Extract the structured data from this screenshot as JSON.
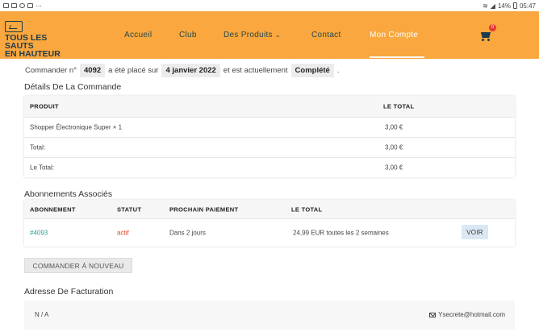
{
  "status_bar": {
    "left_icons": "⋯",
    "time": "05:47",
    "battery": "14%"
  },
  "header": {
    "logo_line1": "TOUS LES SAUTS",
    "logo_line2": "EN HAUTEUR",
    "nav": [
      "Accueil",
      "Club",
      "Des Produits",
      "Contact",
      "Mon Compte"
    ],
    "cart_count": "0",
    "accent_color": "#f9a73e"
  },
  "order": {
    "prefix": "Commander n°",
    "number": "4092",
    "placed_text": "a été placé sur",
    "date": "4 janvier 2022",
    "status_text": "et est actuellement",
    "status": "Complété",
    "end": "."
  },
  "details": {
    "title": "Détails De La Commande",
    "col_product": "PRODUIT",
    "col_total": "LE TOTAL",
    "rows": [
      {
        "label": "Shopper Électronique Super × 1",
        "value": "3,00 €"
      },
      {
        "label": "Total:",
        "value": "3,00 €"
      },
      {
        "label": "Le Total:",
        "value": "3,00 €"
      }
    ]
  },
  "subscriptions": {
    "title": "Abonnements Associés",
    "cols": [
      "ABONNEMENT",
      "STATUT",
      "PROCHAIN PAIEMENT",
      "LE TOTAL"
    ],
    "row": {
      "id": "#4093",
      "status": "actif",
      "next_payment": "Dans 2 jours",
      "total": "24,99 EUR toutes les 2 semaines",
      "action": "VOIR"
    }
  },
  "reorder_button": "COMMANDER À NOUVEAU",
  "billing": {
    "title": "Adresse De Facturation",
    "address": "N / A",
    "email": "Ysecrete@hotmail.com"
  }
}
